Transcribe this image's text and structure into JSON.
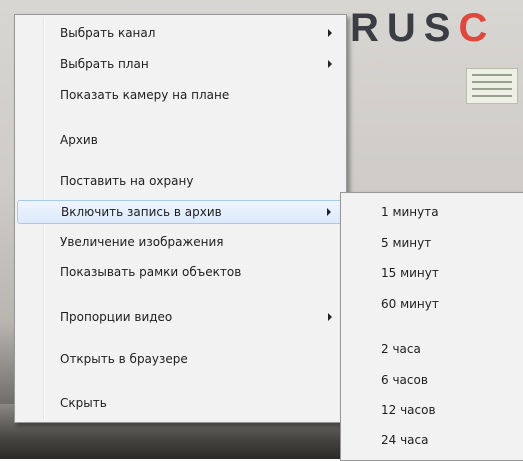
{
  "background": {
    "wall_text_dark": "RUS",
    "wall_text_red": "C"
  },
  "context_menu": {
    "items": [
      {
        "label": "Выбрать канал",
        "has_submenu": true
      },
      {
        "label": "Выбрать план",
        "has_submenu": true
      },
      {
        "label": "Показать камеру на плане",
        "has_submenu": false
      },
      {
        "label": "Архив",
        "has_submenu": false
      },
      {
        "label": "Поставить на охрану",
        "has_submenu": false
      },
      {
        "label": "Включить запись в архив",
        "has_submenu": true,
        "highlighted": true
      },
      {
        "label": "Увеличение изображения",
        "has_submenu": false
      },
      {
        "label": "Показывать рамки объектов",
        "has_submenu": false
      },
      {
        "label": "Пропорции видео",
        "has_submenu": true
      },
      {
        "label": "Открыть в браузере",
        "has_submenu": false
      },
      {
        "label": "Скрыть",
        "has_submenu": false
      }
    ]
  },
  "record_submenu": {
    "items": [
      {
        "label": "1 минута"
      },
      {
        "label": "5 минут"
      },
      {
        "label": "15 минут"
      },
      {
        "label": "60 минут"
      },
      {
        "label": "2 часа"
      },
      {
        "label": "6 часов"
      },
      {
        "label": "12 часов"
      },
      {
        "label": "24 часа"
      }
    ]
  },
  "colors": {
    "menu_bg": "#f2f2f2",
    "highlight_bg": "#dceafc",
    "highlight_border": "#a8c8ec",
    "wall_text_red": "#e0483e"
  }
}
